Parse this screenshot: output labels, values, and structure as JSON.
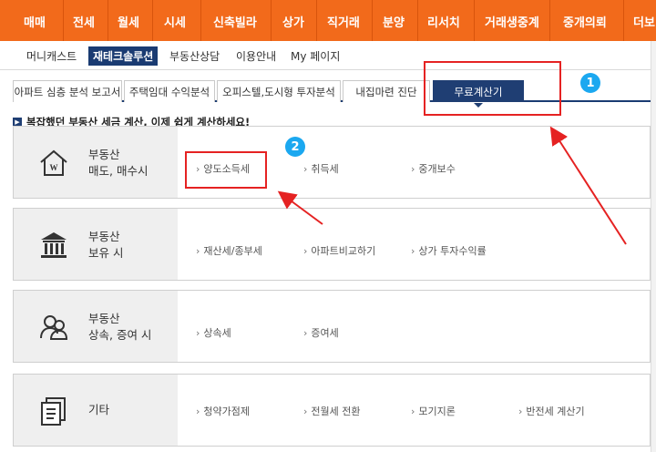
{
  "topnav": {
    "items": [
      "매매",
      "전세",
      "월세",
      "시세",
      "신축빌라",
      "상가",
      "직거래",
      "분양",
      "리서치",
      "거래생중계",
      "중개의뢰",
      "더보"
    ]
  },
  "subnav": {
    "items": [
      "머니캐스트",
      "재테크솔루션",
      "부동산상담",
      "이용안내",
      "My 페이지"
    ],
    "active_index": 1
  },
  "tabs": {
    "items": [
      "아파트 심층 분석 보고서",
      "주택임대 수익분석",
      "오피스텔,도시형 투자분석",
      "내집마련 진단",
      "무료계산기"
    ],
    "active_index": 4
  },
  "notice": "복잡했던 부동산 세금 계산, 이제 쉽게 계산하세요!",
  "sections": [
    {
      "icon": "house-icon",
      "category_line1": "부동산",
      "category_line2": "매도, 매수시",
      "links": [
        "양도소득세",
        "취득세",
        "중개보수"
      ]
    },
    {
      "icon": "bank-building-icon",
      "category_line1": "부동산",
      "category_line2": "보유 시",
      "links": [
        "재산세/종부세",
        "아파트비교하기",
        "상가 투자수익률"
      ]
    },
    {
      "icon": "people-icon",
      "category_line1": "부동산",
      "category_line2": "상속, 증여 시",
      "links": [
        "상속세",
        "증여세"
      ]
    },
    {
      "icon": "documents-icon",
      "category_line1": "기타",
      "category_line2": "",
      "links": [
        "청약가점제",
        "전월세 전환",
        "모기지론",
        "반전세 계산기"
      ]
    }
  ],
  "annotations": {
    "badge1": "1",
    "badge2": "2",
    "highlight_color": "#e52222",
    "badge_color": "#1ba8f0"
  },
  "colors": {
    "nav_orange": "#f26a1b",
    "navy": "#1f3e73"
  }
}
